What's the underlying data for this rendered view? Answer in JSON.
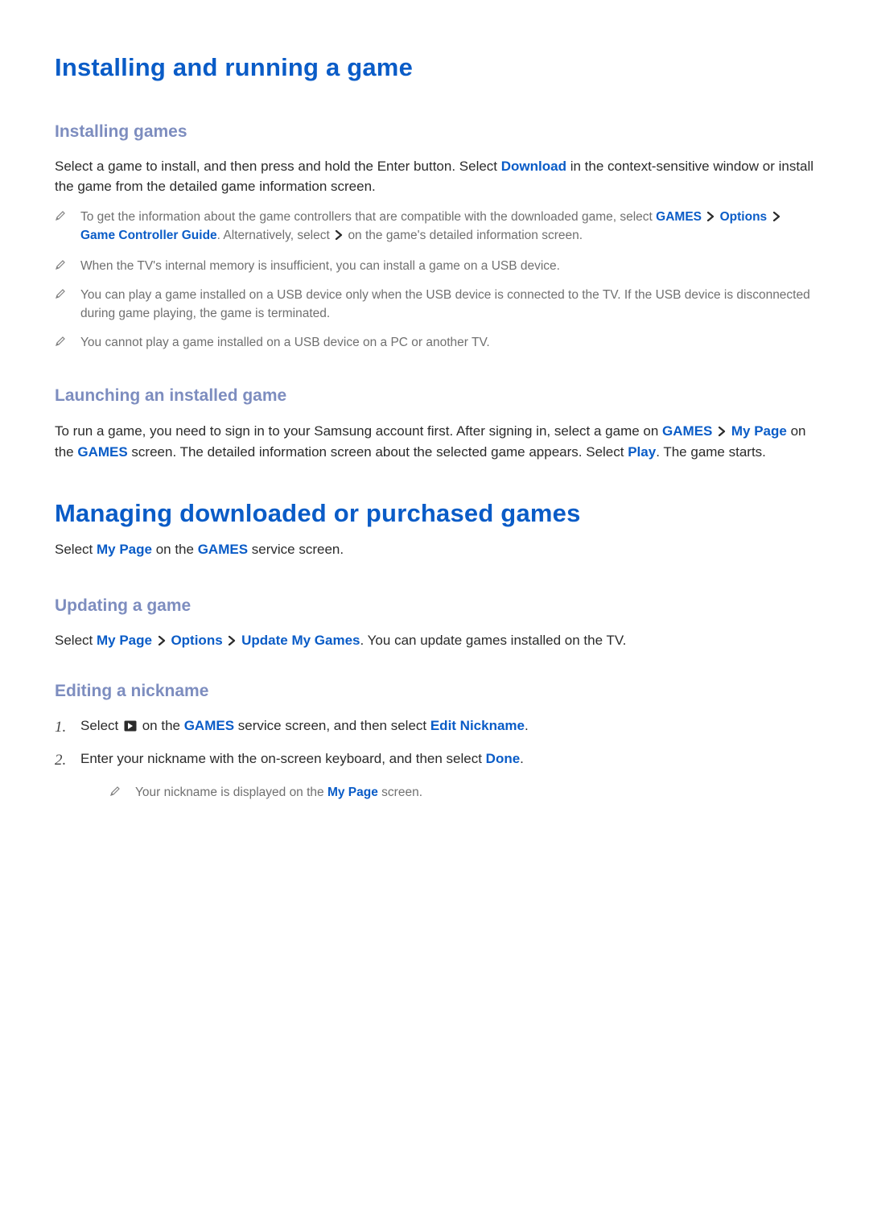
{
  "section1": {
    "title": "Installing and running a game",
    "sub1": {
      "heading": "Installing games",
      "intro_a": "Select a game to install, and then press and hold the Enter button. Select ",
      "intro_download": "Download",
      "intro_b": " in the context-sensitive window or install the game from the detailed game information screen.",
      "notes": {
        "n1_a": "To get the information about the game controllers that are compatible with the downloaded game, select ",
        "n1_games": "GAMES",
        "n1_options": "Options",
        "n1_guide": "Game Controller Guide",
        "n1_b": ". Alternatively, select ",
        "n1_c": " on the game's detailed information screen.",
        "n2": "When the TV's internal memory is insufficient, you can install a game on a USB device.",
        "n3": "You can play a game installed on a USB device only when the USB device is connected to the TV. If the USB device is disconnected during game playing, the game is terminated.",
        "n4": "You cannot play a game installed on a USB device on a PC or another TV."
      }
    },
    "sub2": {
      "heading": "Launching an installed game",
      "p_a": "To run a game, you need to sign in to your Samsung account first. After signing in, select a game on ",
      "p_games": "GAMES",
      "p_mypage": "My Page",
      "p_b": " on the ",
      "p_games2": "GAMES",
      "p_c": " screen. The detailed information screen about the selected game appears. Select ",
      "p_play": "Play",
      "p_d": ". The game starts."
    }
  },
  "section2": {
    "title": "Managing downloaded or purchased games",
    "intro_a": "Select ",
    "intro_mypage": "My Page",
    "intro_b": " on the ",
    "intro_games": "GAMES",
    "intro_c": " service screen.",
    "sub1": {
      "heading": "Updating a game",
      "p_a": "Select ",
      "p_mypage": "My Page",
      "p_options": "Options",
      "p_update": "Update My Games",
      "p_b": ". You can update games installed on the TV."
    },
    "sub2": {
      "heading": "Editing a nickname",
      "s1_num": "1.",
      "s1_a": "Select ",
      "s1_b": " on the ",
      "s1_games": "GAMES",
      "s1_c": " service screen, and then select ",
      "s1_edit": "Edit Nickname",
      "s1_d": ".",
      "s2_num": "2.",
      "s2_a": "Enter your nickname with the on-screen keyboard, and then select ",
      "s2_done": "Done",
      "s2_b": ".",
      "note_a": "Your nickname is displayed on the ",
      "note_mypage": "My Page",
      "note_b": " screen."
    }
  }
}
